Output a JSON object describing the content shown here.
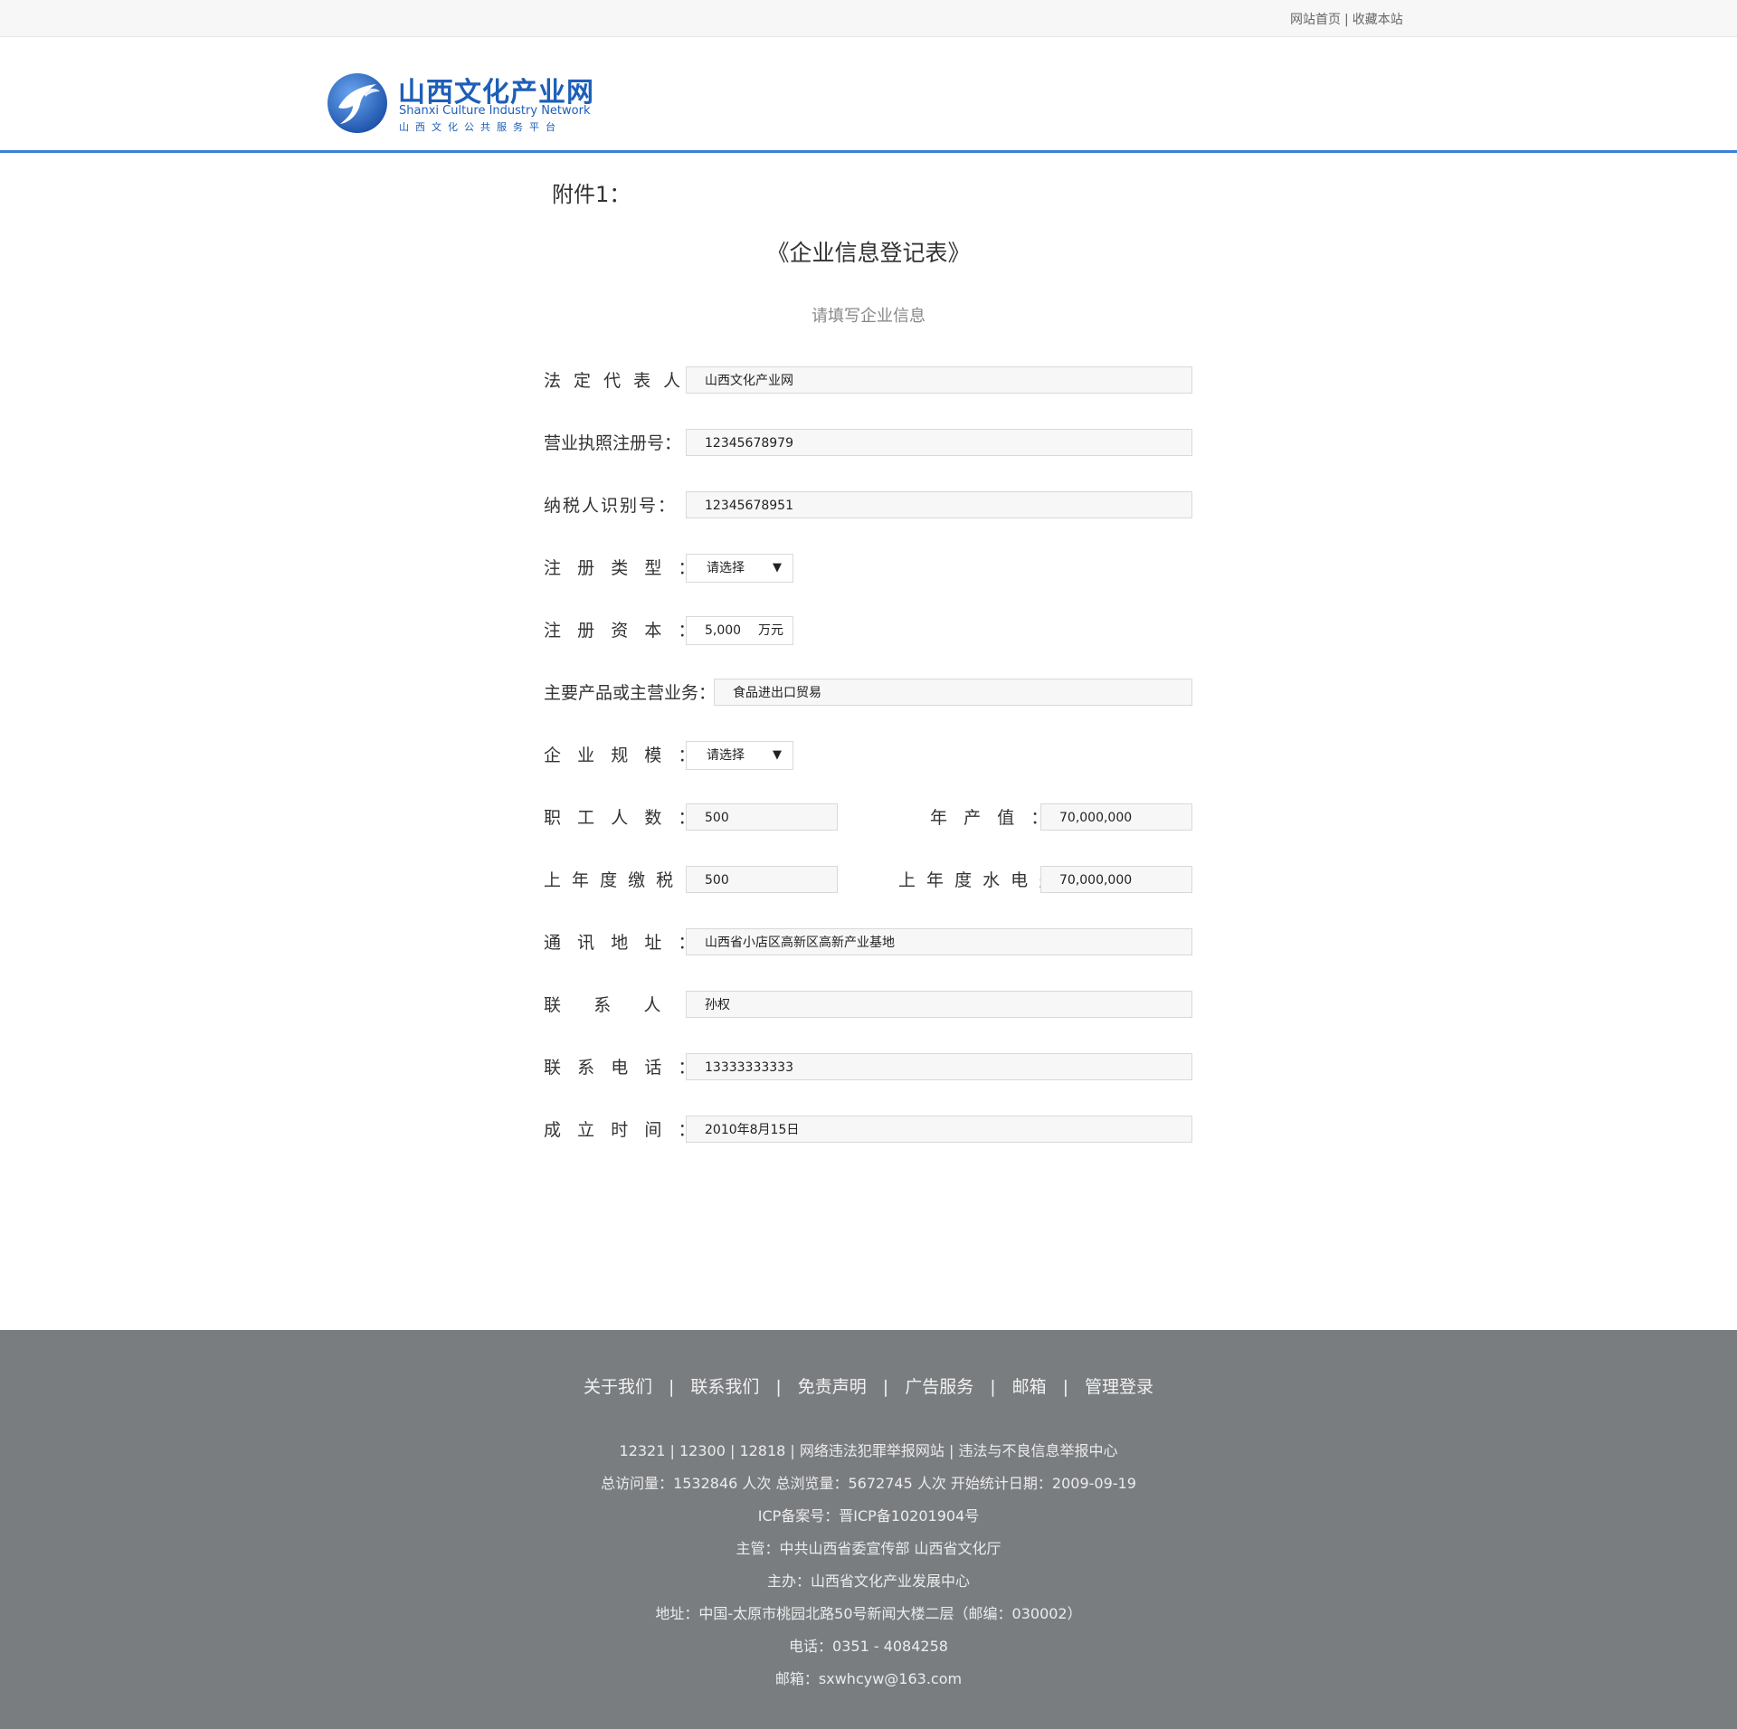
{
  "topbar": {
    "home_link": "网站首页",
    "separator": "|",
    "bookmark_link": "收藏本站"
  },
  "logo": {
    "name_cn": "山西文化产业网",
    "name_en": "Shanxi Culture Industry Network",
    "tagline": "山西文化公共服务平台",
    "brand_color": "#1d5fb8"
  },
  "page": {
    "attachment_label": "附件1：",
    "title": "《企业信息登记表》",
    "subtitle": "请填写企业信息"
  },
  "form": {
    "legal_rep": {
      "label": "法 定 代 表 人 ：",
      "value": "山西文化产业网"
    },
    "license_no": {
      "label": "营业执照注册号：",
      "value": "12345678979"
    },
    "tax_id": {
      "label": "纳税人识别号：",
      "value": "12345678951"
    },
    "reg_type": {
      "label": "注   册   类   型   ：",
      "value": "请选择",
      "icon": "caret-down-icon"
    },
    "reg_capital": {
      "label": "注   册   资   本   ：",
      "value": "5,000",
      "unit": "万元"
    },
    "main_business": {
      "label": "主要产品或主营业务：",
      "value": "食品进出口贸易"
    },
    "scale": {
      "label": "企   业   规   模   ：",
      "value": "请选择",
      "icon": "caret-down-icon"
    },
    "employees": {
      "label": "职   工   人   数   ：",
      "value": "500"
    },
    "annual_output": {
      "label": "年   产   值   ：",
      "value": "70,000,000"
    },
    "last_year_tax": {
      "label": "上 年 度 缴 税 ：",
      "value": "500"
    },
    "last_year_utilities": {
      "label": "上 年 度 水 电 费 ：",
      "value": "70,000,000"
    },
    "address": {
      "label": "通   讯   地   址   ：",
      "value": "山西省小店区高新区高新产业基地"
    },
    "contact": {
      "label": "联      系      人      ：",
      "value": "孙权"
    },
    "phone": {
      "label": "联   系   电   话   ：",
      "value": "13333333333"
    },
    "founded": {
      "label": "成   立   时   间   ：",
      "value": "2010年8月15日"
    }
  },
  "footer": {
    "nav": [
      "关于我们",
      "联系我们",
      "免责声明",
      "广告服务",
      "邮箱",
      "管理登录"
    ],
    "nav_separator": "|",
    "lines": {
      "hotlines": "12321 | 12300 | 12818 | 网络违法犯罪举报网站 | 违法与不良信息举报中心",
      "stats": "总访问量：1532846 人次  总浏览量：5672745 人次  开始统计日期：2009-09-19",
      "icp": "ICP备案号：晋ICP备10201904号",
      "supervisor": "主管：中共山西省委宣传部 山西省文化厅",
      "organizer": "主办：山西省文化产业发展中心",
      "address": "地址：中国-太原市桃园北路50号新闻大楼二层（邮编：030002）",
      "phone": "电话：0351 - 4084258",
      "email": "邮箱：sxwhcyw@163.com"
    },
    "bg_color": "#7a7d80"
  },
  "colors": {
    "header_rule": "#3b7fd6",
    "field_bg": "#f7f7f7"
  }
}
